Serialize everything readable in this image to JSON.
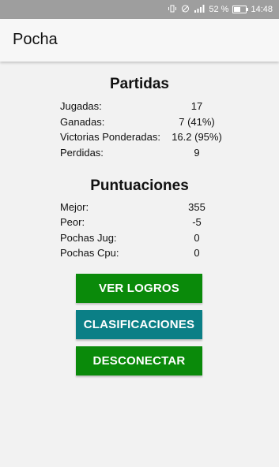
{
  "status_bar": {
    "battery": "52 %",
    "battery_level": 0.52,
    "time": "14:48",
    "icons": [
      "vibrate-icon",
      "silent-icon",
      "signal-icon",
      "battery-icon"
    ]
  },
  "app_bar": {
    "title": "Pocha"
  },
  "partidas": {
    "heading": "Partidas",
    "rows": [
      {
        "label": "Jugadas:",
        "value": "17"
      },
      {
        "label": "Ganadas:",
        "value": "7 (41%)"
      },
      {
        "label": "Victorias Ponderadas:",
        "value": "16.2 (95%)"
      },
      {
        "label": "Perdidas:",
        "value": "9"
      }
    ]
  },
  "puntuaciones": {
    "heading": "Puntuaciones",
    "rows": [
      {
        "label": "Mejor:",
        "value": "355"
      },
      {
        "label": "Peor:",
        "value": "-5"
      },
      {
        "label": "Pochas Jug:",
        "value": "0"
      },
      {
        "label": "Pochas Cpu:",
        "value": "0"
      }
    ]
  },
  "buttons": {
    "ver_logros": {
      "label": "VER LOGROS",
      "color": "#0a8a0a"
    },
    "clasificaciones": {
      "label": "CLASIFICACIONES",
      "color": "#0b7f86"
    },
    "desconectar": {
      "label": "DESCONECTAR",
      "color": "#0a8a0a"
    }
  },
  "colors": {
    "status_bar": "#9e9e9e",
    "background": "#f2f2f2",
    "app_bar": "#f7f7f7"
  }
}
